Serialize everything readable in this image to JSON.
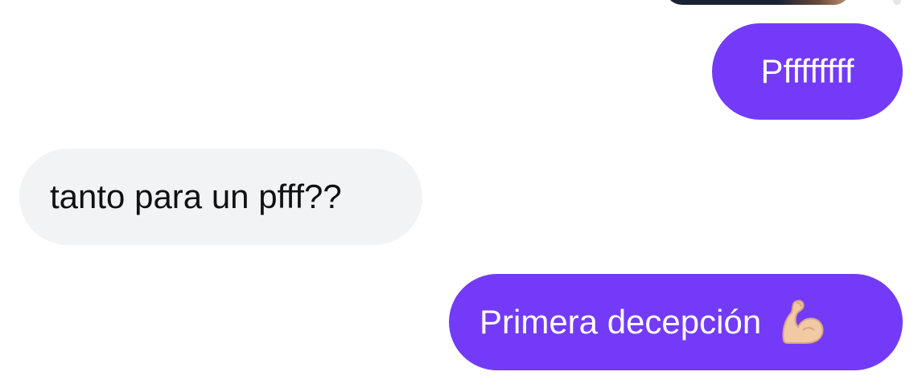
{
  "conversation": {
    "messages": [
      {
        "direction": "outgoing",
        "text": "Pffffffff"
      },
      {
        "direction": "incoming",
        "text": "tanto para un pfff??"
      },
      {
        "direction": "outgoing",
        "text": "Primera decepción",
        "emoji": "flexed-biceps-icon"
      }
    ]
  },
  "colors": {
    "outgoing_bubble": "#733bf7",
    "incoming_bubble": "#f2f3f5",
    "outgoing_text": "#ffffff",
    "incoming_text": "#111111"
  }
}
